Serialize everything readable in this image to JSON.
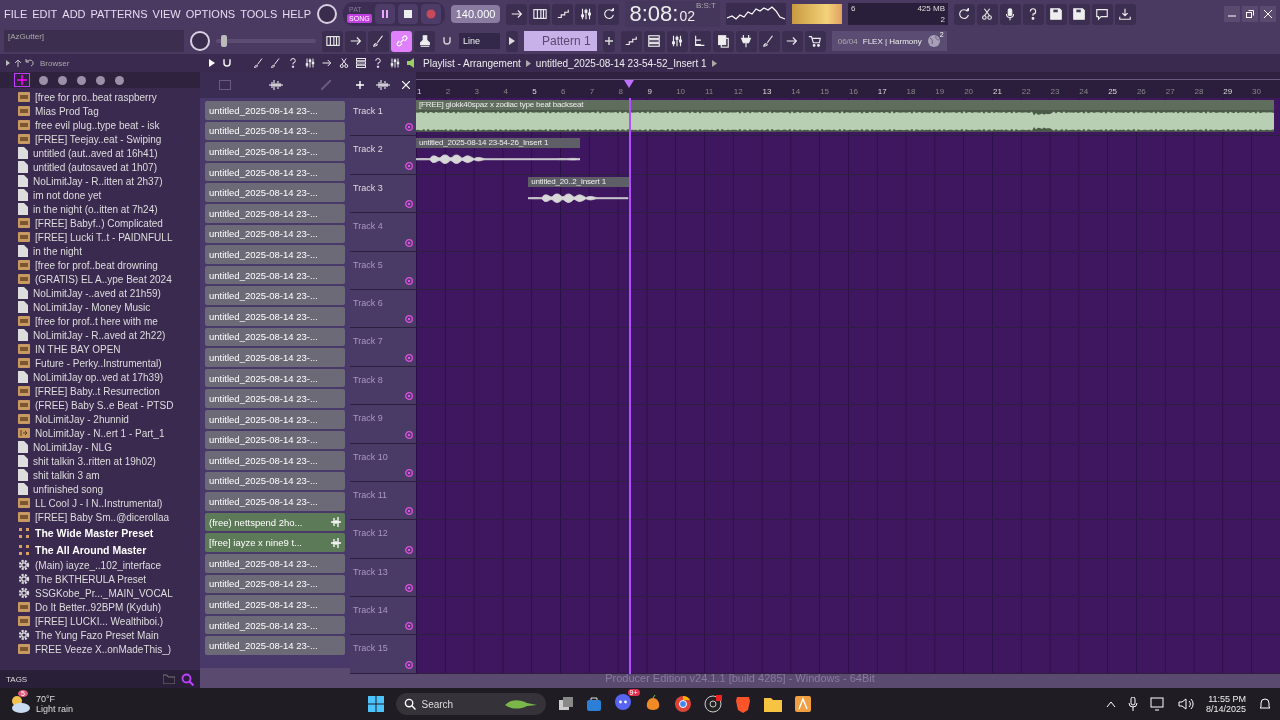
{
  "menu": [
    "FILE",
    "EDIT",
    "ADD",
    "PATTERNS",
    "VIEW",
    "OPTIONS",
    "TOOLS",
    "HELP"
  ],
  "hint_bar": {
    "text": "[AzGutter]"
  },
  "transport": {
    "modes": [
      {
        "label": "PAT",
        "selected": false
      },
      {
        "label": "SONG",
        "selected": true
      }
    ],
    "playing": true,
    "recording": false,
    "tempo": "140.000"
  },
  "clock": {
    "time": "8:08:",
    "seconds": "02",
    "unit": "B:S:T"
  },
  "performance": {
    "cpu": "6",
    "memory": "425 MB",
    "polyphony": "2"
  },
  "link_mode": true,
  "snap": {
    "value": "Line"
  },
  "pattern_selector": {
    "value": "Pattern 1"
  },
  "news": {
    "date": "06/04",
    "text": "FLEX | Harmony",
    "badge": "2"
  },
  "browser": {
    "title": "Browser",
    "tags_label": "TAGS",
    "items": [
      {
        "label": "[free for pro..beat raspberry",
        "kind": "audio"
      },
      {
        "label": "Mias Prod Tag",
        "kind": "audio"
      },
      {
        "label": "free evil plug..type beat - isk",
        "kind": "audio"
      },
      {
        "label": "[FREE] Teejay..eat - Swiping",
        "kind": "audio"
      },
      {
        "label": "untitled (aut..aved at 16h41)",
        "kind": "project"
      },
      {
        "label": "untitled (autosaved at 1h07)",
        "kind": "project"
      },
      {
        "label": "NoLimitJay - R..itten at 2h37)",
        "kind": "project"
      },
      {
        "label": "im not done yet",
        "kind": "project"
      },
      {
        "label": "in the night (o..itten at 7h24)",
        "kind": "project"
      },
      {
        "label": "[FREE] Babyf..) Complicated",
        "kind": "audio"
      },
      {
        "label": "[FREE] Lucki T..t - PAIDNFULL",
        "kind": "audio"
      },
      {
        "label": "in the night",
        "kind": "project"
      },
      {
        "label": "[free for prof..beat drowning",
        "kind": "audio"
      },
      {
        "label": "(GRATIS) EL A..ype Beat 2024",
        "kind": "audio"
      },
      {
        "label": "NoLimitJay -..aved at 21h59)",
        "kind": "project"
      },
      {
        "label": "NoLimitJay - Money Music",
        "kind": "project"
      },
      {
        "label": "[free for prof..t here with me",
        "kind": "audio"
      },
      {
        "label": "NoLimitJay - R..aved at 2h22)",
        "kind": "project"
      },
      {
        "label": "IN THE BAY OPEN",
        "kind": "audio"
      },
      {
        "label": "Future - Perky..Instrumental)",
        "kind": "audio"
      },
      {
        "label": "NoLimitJay op..ved at 17h39)",
        "kind": "project"
      },
      {
        "label": "[FREE] Baby..t Resurrection",
        "kind": "audio"
      },
      {
        "label": "(FREE) Baby S..e Beat - PTSD",
        "kind": "audio"
      },
      {
        "label": "NoLimitJay - 2hunnid",
        "kind": "audio"
      },
      {
        "label": "NoLimitJay - N..ert 1 - Part_1",
        "kind": "clip"
      },
      {
        "label": "NoLimitJay - NLG",
        "kind": "project"
      },
      {
        "label": "shit talkin 3..ritten at 19h02)",
        "kind": "project"
      },
      {
        "label": "shit talkin 3 am",
        "kind": "project"
      },
      {
        "label": "unfinished song",
        "kind": "project"
      },
      {
        "label": "LL Cool J - I N..Instrumental)",
        "kind": "audio"
      },
      {
        "label": "[FREE] Baby Sm..@dicerollaa",
        "kind": "audio"
      },
      {
        "label": "The Wide Master Preset",
        "kind": "mixer"
      },
      {
        "label": "The All Around Master",
        "kind": "mixer"
      },
      {
        "label": "(Main) iayze_..102_interface",
        "kind": "plugin"
      },
      {
        "label": "The BKTHERULA Preset",
        "kind": "plugin"
      },
      {
        "label": "SSGKobe_Pr..._MAIN_VOCAL",
        "kind": "plugin"
      },
      {
        "label": "Do It Better..92BPM (Kyduh)",
        "kind": "audio"
      },
      {
        "label": "[FREE] LUCKI... Wealthiboi.)",
        "kind": "audio"
      },
      {
        "label": "The Yung Fazo Preset Main",
        "kind": "plugin"
      },
      {
        "label": "FREE Veeze X..onMadeThis_)",
        "kind": "audio"
      }
    ]
  },
  "pattern_list": {
    "items": [
      {
        "label": "untitled_2025-08-14 23-...",
        "kind": "pattern"
      },
      {
        "label": "untitled_2025-08-14 23-...",
        "kind": "pattern"
      },
      {
        "label": "untitled_2025-08-14 23-...",
        "kind": "pattern"
      },
      {
        "label": "untitled_2025-08-14 23-...",
        "kind": "pattern"
      },
      {
        "label": "untitled_2025-08-14 23-...",
        "kind": "pattern"
      },
      {
        "label": "untitled_2025-08-14 23-...",
        "kind": "pattern"
      },
      {
        "label": "untitled_2025-08-14 23-...",
        "kind": "pattern"
      },
      {
        "label": "untitled_2025-08-14 23-...",
        "kind": "pattern"
      },
      {
        "label": "untitled_2025-08-14 23-...",
        "kind": "pattern"
      },
      {
        "label": "untitled_2025-08-14 23-...",
        "kind": "pattern"
      },
      {
        "label": "untitled_2025-08-14 23-...",
        "kind": "pattern"
      },
      {
        "label": "untitled_2025-08-14 23-...",
        "kind": "pattern"
      },
      {
        "label": "untitled_2025-08-14 23-...",
        "kind": "pattern"
      },
      {
        "label": "untitled_2025-08-14 23-...",
        "kind": "pattern"
      },
      {
        "label": "untitled_2025-08-14 23-...",
        "kind": "pattern"
      },
      {
        "label": "untitled_2025-08-14 23-...",
        "kind": "pattern"
      },
      {
        "label": "untitled_2025-08-14 23-...",
        "kind": "pattern"
      },
      {
        "label": "untitled_2025-08-14 23-...",
        "kind": "pattern"
      },
      {
        "label": "untitled_2025-08-14 23-...",
        "kind": "pattern"
      },
      {
        "label": "untitled_2025-08-14 23-...",
        "kind": "pattern"
      },
      {
        "label": "(free) nettspend  2ho...",
        "kind": "audio"
      },
      {
        "label": "[free] iayze x nine9 t...",
        "kind": "audio"
      },
      {
        "label": "untitled_2025-08-14 23-...",
        "kind": "pattern"
      },
      {
        "label": "untitled_2025-08-14 23-...",
        "kind": "pattern"
      },
      {
        "label": "untitled_2025-08-14 23-...",
        "kind": "pattern"
      },
      {
        "label": "untitled_2025-08-14 23-...",
        "kind": "pattern"
      },
      {
        "label": "untitled_2025-08-14 23-...",
        "kind": "pattern"
      }
    ]
  },
  "pitch_slider": {
    "level": 0.05
  },
  "playlist": {
    "title": "Playlist - Arrangement",
    "current": "untitled_2025-08-14 23-54-52_Insert 1",
    "ruler": [
      "1",
      "2",
      "3",
      "4",
      "5",
      "6",
      "7",
      "8",
      "9",
      "10",
      "11",
      "12",
      "13",
      "14",
      "15",
      "16",
      "17",
      "18",
      "19",
      "20",
      "21",
      "22",
      "23",
      "24",
      "25",
      "26",
      "27",
      "28",
      "29",
      "30"
    ],
    "tracks": [
      {
        "name": "Track 1",
        "clips": [
          {
            "label": "[FREE] glokk40spaz x zodiac type beat backseat",
            "kind": "dense"
          }
        ]
      },
      {
        "name": "Track 2",
        "clips": [
          {
            "label": "untitled_2025-08-14 23-54-26_Insert 1",
            "kind": "sparse"
          }
        ]
      },
      {
        "name": "Track 3",
        "clips": [
          {
            "label": "untitled_20..2_Insert 1",
            "kind": "sparse"
          }
        ]
      },
      {
        "name": "Track 4"
      },
      {
        "name": "Track 5"
      },
      {
        "name": "Track 6"
      },
      {
        "name": "Track 7"
      },
      {
        "name": "Track 8"
      },
      {
        "name": "Track 9"
      },
      {
        "name": "Track 10"
      },
      {
        "name": "Track 11"
      },
      {
        "name": "Track 12"
      },
      {
        "name": "Track 13"
      },
      {
        "name": "Track 14"
      },
      {
        "name": "Track 15"
      }
    ]
  },
  "status_bar": {
    "text": "Producer Edition v24.1.1 [build 4285] - Windows - 64Bit"
  },
  "taskbar": {
    "weather": {
      "temperature": "70°F",
      "condition": "Light rain",
      "badge": "5"
    },
    "search_placeholder": "Search",
    "chat_badge": "9+",
    "time": "11:55 PM",
    "date": "8/14/2025"
  }
}
